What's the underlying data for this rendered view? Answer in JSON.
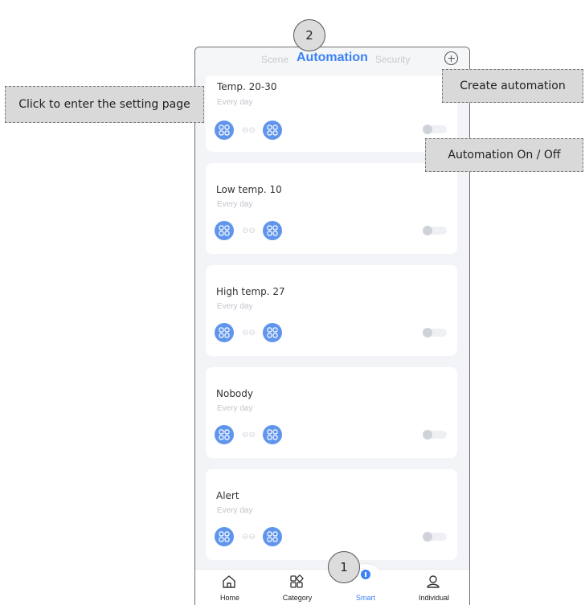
{
  "tabs": {
    "scene": "Scene",
    "automation": "Automation",
    "security": "Security"
  },
  "automations": [
    {
      "title": "Temp. 20-30",
      "schedule": "Every day",
      "enabled": false
    },
    {
      "title": "Low temp. 10",
      "schedule": "Every day",
      "enabled": false
    },
    {
      "title": "High temp. 27",
      "schedule": "Every day",
      "enabled": false
    },
    {
      "title": "Nobody",
      "schedule": "Every day",
      "enabled": false
    },
    {
      "title": "Alert",
      "schedule": "Every day",
      "enabled": false
    }
  ],
  "nav": {
    "home": "Home",
    "category": "Category",
    "smart": "Smart",
    "individual": "Individual"
  },
  "callouts": {
    "enter_setting": "Click to enter the setting page",
    "create": "Create automation",
    "onoff": "Automation On / Off"
  },
  "markers": {
    "one": "1",
    "two": "2"
  },
  "colors": {
    "accent": "#3b82f6",
    "device_icon": "#5f95ec",
    "callout_bg": "#d9d9d9"
  }
}
